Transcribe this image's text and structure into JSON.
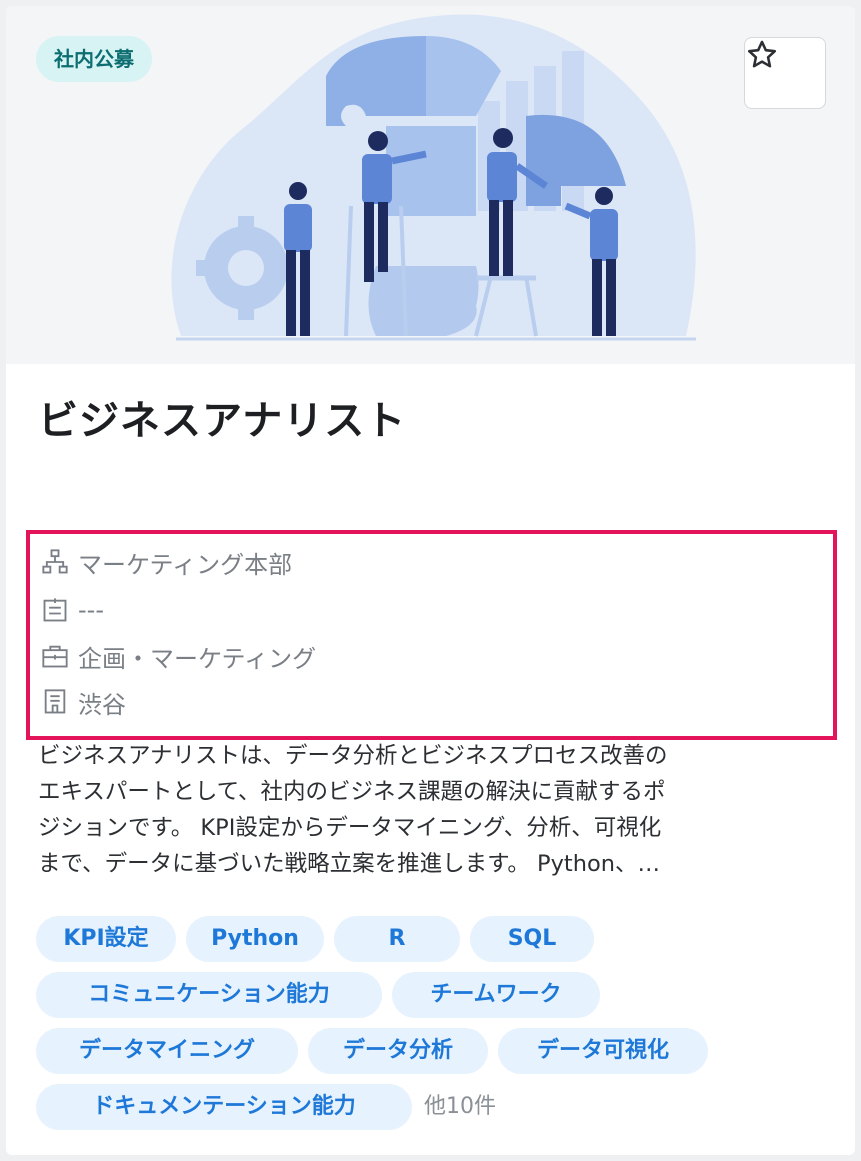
{
  "card": {
    "badge": "社内公募",
    "title": "ビジネスアナリスト",
    "meta": [
      {
        "icon": "org-chart-icon",
        "text": "マーケティング本部"
      },
      {
        "icon": "id-card-icon",
        "text": "---"
      },
      {
        "icon": "briefcase-icon",
        "text": "企画・マーケティング"
      },
      {
        "icon": "building-icon",
        "text": "渋谷"
      }
    ],
    "description_lines": [
      "ビジネスアナリストは、データ分析とビジネスプロセス改善の",
      "エキスパートとして、社内のビジネス課題の解決に貢献するポ",
      "ジションです。 KPI設定からデータマイニング、分析、可視化",
      "まで、データに基づいた戦略立案を推進します。 Python、…"
    ],
    "tags": [
      "KPI設定",
      "Python",
      "R",
      "SQL",
      "コミュニケーション能力",
      "チームワーク",
      "データマイニング",
      "データ分析",
      "データ可視化",
      "ドキュメンテーション能力"
    ],
    "more_tags": "他10件"
  },
  "colors": {
    "badge_bg": "#d7f3f3",
    "badge_text": "#0c6e71",
    "tag_bg": "#e6f2fd",
    "tag_text": "#1d78d8",
    "highlight": "#e3145a"
  },
  "icons": {
    "favorite": "star-outline-icon",
    "hero": "team-puzzle-illustration"
  }
}
